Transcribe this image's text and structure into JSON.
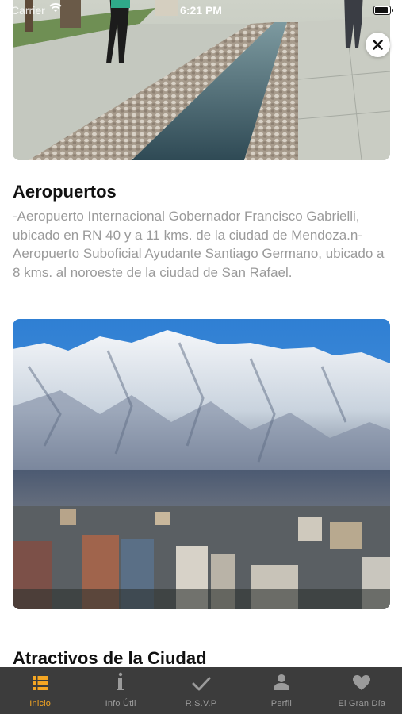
{
  "status_bar": {
    "carrier": "Carrier",
    "time": "6:21 PM",
    "battery_level": 0.9
  },
  "close_button": {
    "icon": "close-icon"
  },
  "sections": [
    {
      "image": "plaza-water-channel-photo",
      "title": "Aeropuertos",
      "body": "-Aeropuerto Internacional Gobernador Francisco Gabrielli, ubicado en RN 40 y a 11 kms. de la ciudad de Mendoza.n-Aeropuerto Suboficial Ayudante Santiago Germano, ubicado a 8 kms. al noroeste de la ciudad de San Rafael."
    },
    {
      "image": "snowy-mountains-city-photo",
      "title": "Atractivos de la Ciudad"
    }
  ],
  "tab_bar": {
    "active_color": "#f5a623",
    "inactive_color": "#9b9b9b",
    "background": "#3c3c3c",
    "tabs": [
      {
        "label": "Inicio",
        "icon": "list-icon",
        "active": true
      },
      {
        "label": "Info Útil",
        "icon": "info-icon",
        "active": false
      },
      {
        "label": "R.S.V.P",
        "icon": "checkmark-icon",
        "active": false
      },
      {
        "label": "Perfil",
        "icon": "person-icon",
        "active": false
      },
      {
        "label": "El Gran Día",
        "icon": "heart-icon",
        "active": false
      }
    ]
  }
}
